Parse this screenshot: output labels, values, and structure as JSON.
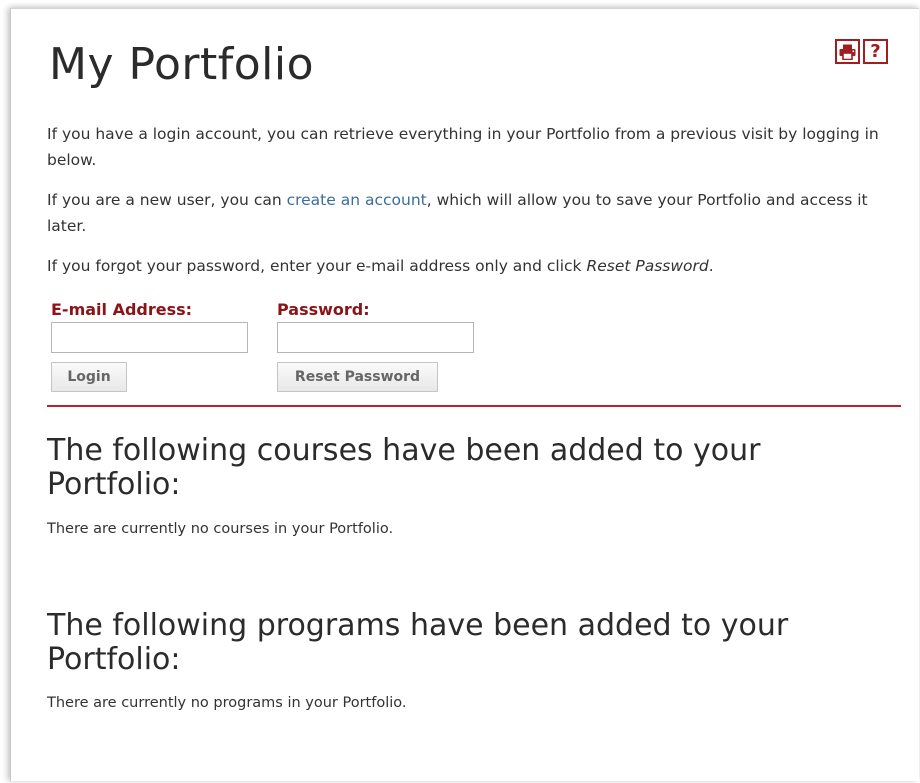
{
  "page": {
    "title": "My Portfolio"
  },
  "toolbar": {
    "print_icon": "printer-icon",
    "help_icon": "question-mark-icon",
    "help_glyph": "?"
  },
  "intro": {
    "p1": "If you have a login account, you can retrieve everything in your Portfolio from a previous visit by logging in below.",
    "p2_before": "If you are a new user, you can ",
    "p2_link": "create an account",
    "p2_after": ", which will allow you to save your Portfolio and access it later.",
    "p3_before": "If you forgot your password, enter your e-mail address only and click ",
    "p3_italic": "Reset Password",
    "p3_after": "."
  },
  "login_form": {
    "email_label": "E-mail Address:",
    "email_value": "",
    "password_label": "Password:",
    "password_value": "",
    "login_button": "Login",
    "reset_button": "Reset Password"
  },
  "courses": {
    "heading": "The following courses have been added to your Portfolio:",
    "empty_message": "There are currently no courses in your Portfolio."
  },
  "programs": {
    "heading": "The following programs have been added to your Portfolio:",
    "empty_message": "There are currently no programs in your Portfolio."
  },
  "colors": {
    "accent": "#a11d21",
    "label": "#8b1418",
    "link": "#3a6d9e",
    "text": "#333333"
  }
}
